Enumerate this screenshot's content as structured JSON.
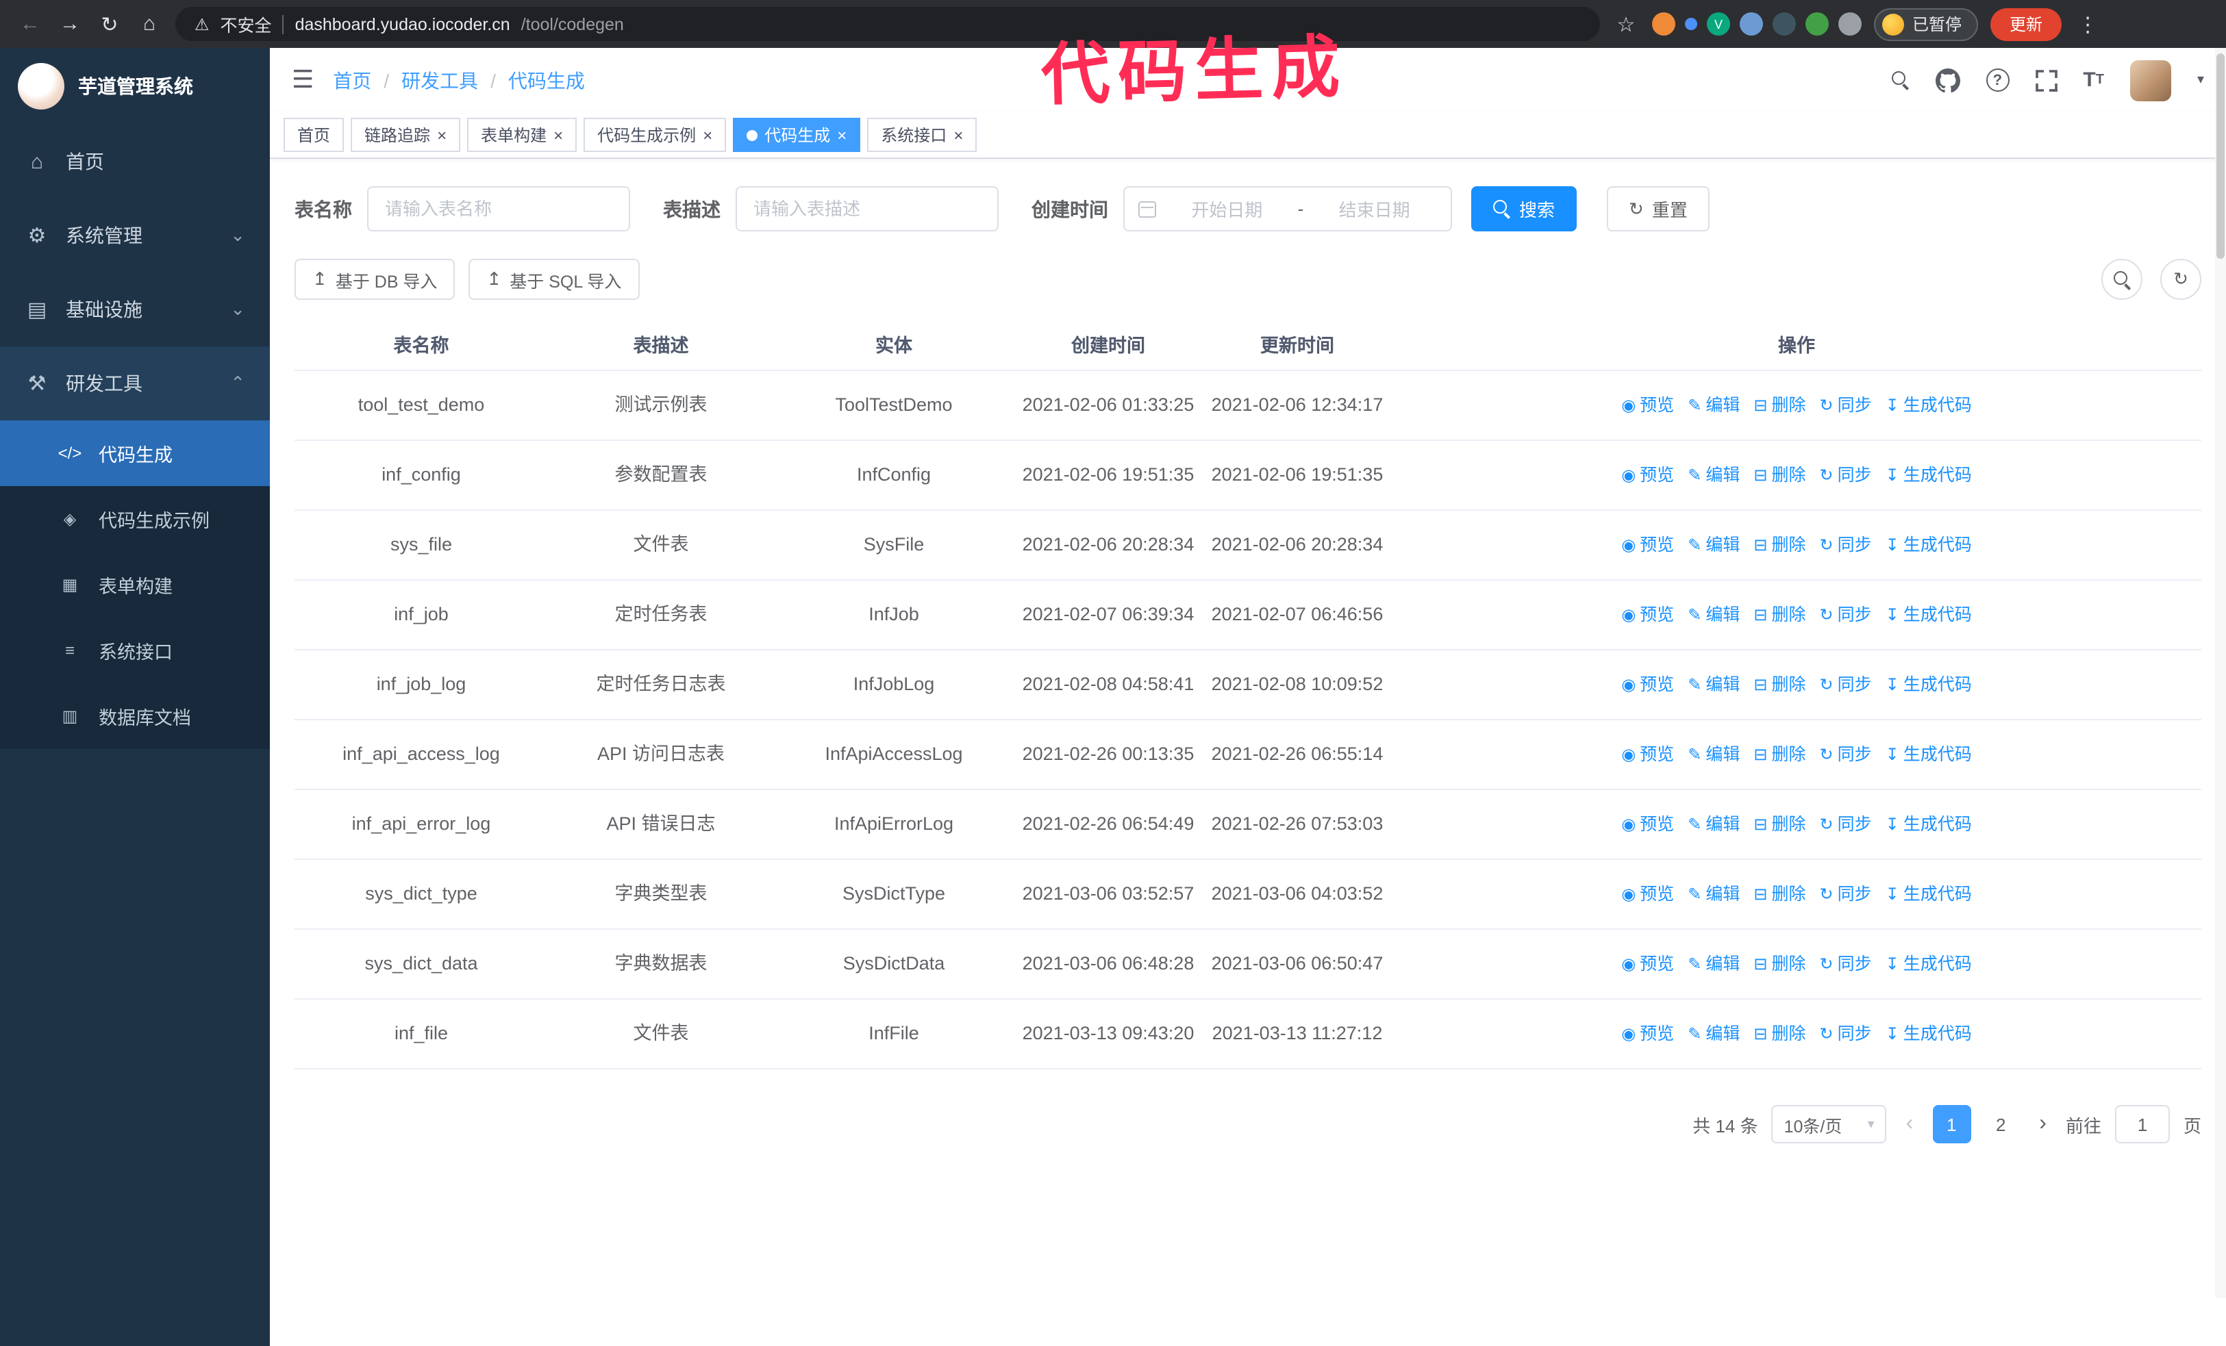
{
  "annotation": {
    "text": "代码生成"
  },
  "browser_bar": {
    "security_text": "不安全",
    "url_host": "dashboard.yudao.iocoder.cn",
    "url_path": "/tool/codegen",
    "paused_badge": "已暂停",
    "update_button": "更新",
    "extensions": [
      {
        "name": "orange-extension-icon",
        "bg": "#ef8b38",
        "glyph": ""
      },
      {
        "name": "blue-dot-extension-icon",
        "bg": "#4d90fe",
        "glyph": "",
        "small": true
      },
      {
        "name": "green-v-extension-icon",
        "bg": "#0aa87f",
        "glyph": "V"
      },
      {
        "name": "people-extension-icon",
        "bg": "#6b9bd2",
        "glyph": ""
      },
      {
        "name": "dark-extension-icon",
        "bg": "#3d5561",
        "glyph": ""
      },
      {
        "name": "leaf-extension-icon",
        "bg": "#43a047",
        "glyph": ""
      },
      {
        "name": "puzzle-extension-icon",
        "bg": "#9aa0a6",
        "glyph": ""
      }
    ]
  },
  "sidebar": {
    "app_title": "芋道管理系统",
    "menu": [
      {
        "key": "home",
        "label": "首页",
        "icon": "home-icon",
        "glyph": "⌂"
      },
      {
        "key": "system",
        "label": "系统管理",
        "icon": "gear-icon",
        "glyph": "⚙",
        "chevron": "down"
      },
      {
        "key": "infrastructure",
        "label": "基础设施",
        "icon": "infrastructure-icon",
        "glyph": "▤",
        "chevron": "down"
      },
      {
        "key": "devtools",
        "label": "研发工具",
        "icon": "tools-icon",
        "glyph": "⚒",
        "chevron": "up",
        "expanded": true,
        "children": [
          {
            "key": "codegen",
            "label": "代码生成",
            "icon": "code-icon",
            "glyph": "</>",
            "active": true
          },
          {
            "key": "codegen-example",
            "label": "代码生成示例",
            "icon": "example-icon",
            "glyph": "◈"
          },
          {
            "key": "form-builder",
            "label": "表单构建",
            "icon": "form-icon",
            "glyph": "▦"
          },
          {
            "key": "system-api",
            "label": "系统接口",
            "icon": "api-icon",
            "glyph": "≡"
          },
          {
            "key": "db-doc",
            "label": "数据库文档",
            "icon": "db-doc-icon",
            "glyph": "▥"
          }
        ]
      }
    ]
  },
  "header": {
    "breadcrumb": [
      "首页",
      "研发工具",
      "代码生成"
    ],
    "separator": "/"
  },
  "tabs": [
    {
      "key": "home",
      "label": "首页",
      "closable": false,
      "active": false
    },
    {
      "key": "tracer",
      "label": "链路追踪",
      "closable": true,
      "active": false
    },
    {
      "key": "form-builder",
      "label": "表单构建",
      "closable": true,
      "active": false
    },
    {
      "key": "codegen-example",
      "label": "代码生成示例",
      "closable": true,
      "active": false
    },
    {
      "key": "codegen",
      "label": "代码生成",
      "closable": true,
      "active": true
    },
    {
      "key": "system-api",
      "label": "系统接口",
      "closable": true,
      "active": false
    }
  ],
  "filters": {
    "table_name_label": "表名称",
    "table_name_placeholder": "请输入表名称",
    "table_desc_label": "表描述",
    "table_desc_placeholder": "请输入表描述",
    "create_time_label": "创建时间",
    "date_start_placeholder": "开始日期",
    "date_separator": "-",
    "date_end_placeholder": "结束日期",
    "search_button": "搜索",
    "reset_button": "重置"
  },
  "toolbar": {
    "import_db": "基于 DB 导入",
    "import_sql": "基于 SQL 导入"
  },
  "table": {
    "columns": [
      "表名称",
      "表描述",
      "实体",
      "创建时间",
      "更新时间",
      "操作"
    ],
    "actions": [
      {
        "key": "preview",
        "label": "预览",
        "icon": "eye-icon",
        "glyph": "◉"
      },
      {
        "key": "edit",
        "label": "编辑",
        "icon": "edit-icon",
        "glyph": "✎"
      },
      {
        "key": "delete",
        "label": "删除",
        "icon": "delete-icon",
        "glyph": "⊟"
      },
      {
        "key": "sync",
        "label": "同步",
        "icon": "sync-icon",
        "glyph": "↻"
      },
      {
        "key": "generate",
        "label": "生成代码",
        "icon": "download-icon",
        "glyph": "↧"
      }
    ],
    "rows": [
      {
        "name": "tool_test_demo",
        "desc": "测试示例表",
        "entity": "ToolTestDemo",
        "created": "2021-02-06 01:33:25",
        "updated": "2021-02-06 12:34:17"
      },
      {
        "name": "inf_config",
        "desc": "参数配置表",
        "entity": "InfConfig",
        "created": "2021-02-06 19:51:35",
        "updated": "2021-02-06 19:51:35"
      },
      {
        "name": "sys_file",
        "desc": "文件表",
        "entity": "SysFile",
        "created": "2021-02-06 20:28:34",
        "updated": "2021-02-06 20:28:34"
      },
      {
        "name": "inf_job",
        "desc": "定时任务表",
        "entity": "InfJob",
        "created": "2021-02-07 06:39:34",
        "updated": "2021-02-07 06:46:56"
      },
      {
        "name": "inf_job_log",
        "desc": "定时任务日志表",
        "entity": "InfJobLog",
        "created": "2021-02-08 04:58:41",
        "updated": "2021-02-08 10:09:52"
      },
      {
        "name": "inf_api_access_log",
        "desc": "API 访问日志表",
        "entity": "InfApiAccessLog",
        "created": "2021-02-26 00:13:35",
        "updated": "2021-02-26 06:55:14"
      },
      {
        "name": "inf_api_error_log",
        "desc": "API 错误日志",
        "entity": "InfApiErrorLog",
        "created": "2021-02-26 06:54:49",
        "updated": "2021-02-26 07:53:03"
      },
      {
        "name": "sys_dict_type",
        "desc": "字典类型表",
        "entity": "SysDictType",
        "created": "2021-03-06 03:52:57",
        "updated": "2021-03-06 04:03:52"
      },
      {
        "name": "sys_dict_data",
        "desc": "字典数据表",
        "entity": "SysDictData",
        "created": "2021-03-06 06:48:28",
        "updated": "2021-03-06 06:50:47"
      },
      {
        "name": "inf_file",
        "desc": "文件表",
        "entity": "InfFile",
        "created": "2021-03-13 09:43:20",
        "updated": "2021-03-13 11:27:12"
      }
    ]
  },
  "pagination": {
    "total_text": "共 14 条",
    "page_size": "10条/页",
    "pages": [
      {
        "label": "1",
        "active": true
      },
      {
        "label": "2",
        "active": false
      }
    ],
    "goto_prefix": "前往",
    "goto_value": "1",
    "goto_suffix": "页"
  }
}
